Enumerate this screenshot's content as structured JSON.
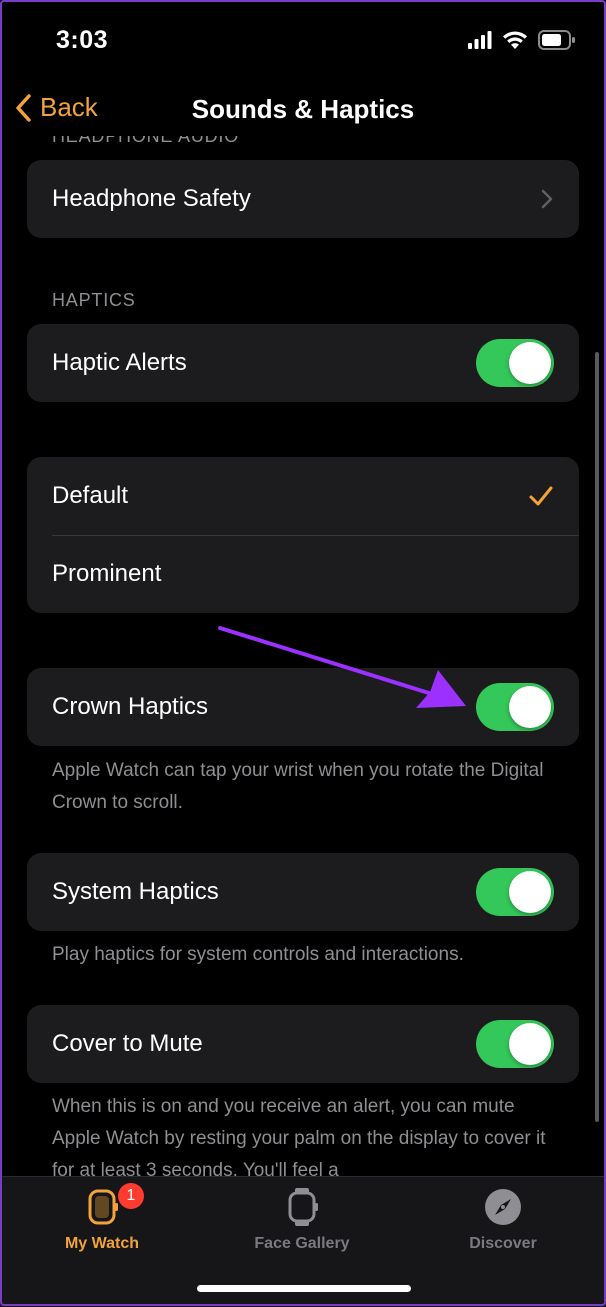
{
  "status_bar": {
    "time": "3:03"
  },
  "nav": {
    "back_label": "Back",
    "title": "Sounds & Haptics"
  },
  "cut_section_header": "HEADPHONE AUDIO",
  "headphone": {
    "label": "Headphone Safety"
  },
  "haptics_section": {
    "header": "HAPTICS",
    "haptic_alerts_label": "Haptic Alerts",
    "haptic_alerts_on": true
  },
  "haptic_style": {
    "options": [
      {
        "label": "Default",
        "selected": true
      },
      {
        "label": "Prominent",
        "selected": false
      }
    ]
  },
  "crown_haptics": {
    "label": "Crown Haptics",
    "on": true,
    "footer": "Apple Watch can tap your wrist when you rotate the Digital Crown to scroll."
  },
  "system_haptics": {
    "label": "System Haptics",
    "on": true,
    "footer": "Play haptics for system controls and interactions."
  },
  "cover_to_mute": {
    "label": "Cover to Mute",
    "on": true,
    "footer": "When this is on and you receive an alert, you can mute Apple Watch by resting your palm on the display to cover it for at least 3 seconds. You'll feel a"
  },
  "tab_bar": {
    "tabs": [
      {
        "label": "My Watch",
        "active": true,
        "badge": "1"
      },
      {
        "label": "Face Gallery",
        "active": false
      },
      {
        "label": "Discover",
        "active": false
      }
    ]
  },
  "colors": {
    "accent": "#f2a33a",
    "toggle_on": "#34c759",
    "annotation_arrow": "#9b30ff",
    "badge": "#ff3b30"
  }
}
